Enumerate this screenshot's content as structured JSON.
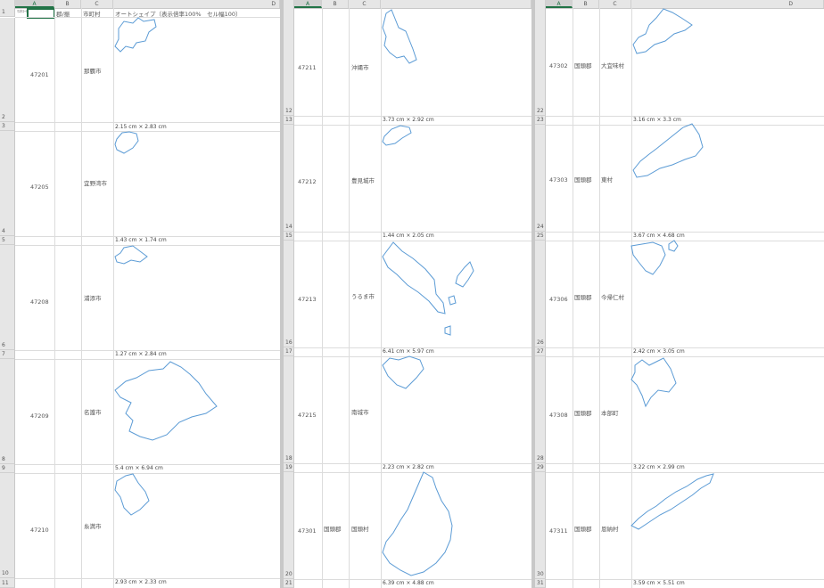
{
  "columns": [
    "A",
    "B",
    "C",
    "D"
  ],
  "header_row": {
    "a1": "ﾏｽﾀｺｰﾄﾞ",
    "b1": "郡/振",
    "c1": "市町村",
    "d1": "オートシェイプ（表示倍率100%　セル幅100）"
  },
  "pane1": {
    "rows": [
      {
        "code": "47201",
        "gun": "",
        "city": "那覇市",
        "dim": "2.15 cm × 2.83 cm",
        "r_top": "2",
        "r_bot": "3"
      },
      {
        "code": "47205",
        "gun": "",
        "city": "宜野湾市",
        "dim": "1.43 cm × 1.74 cm",
        "r_top": "4",
        "r_bot": "5"
      },
      {
        "code": "47208",
        "gun": "",
        "city": "浦添市",
        "dim": "1.27 cm × 2.84 cm",
        "r_top": "6",
        "r_bot": "7"
      },
      {
        "code": "47209",
        "gun": "",
        "city": "名護市",
        "dim": "5.4 cm × 6.94 cm",
        "r_top": "8",
        "r_bot": "9"
      },
      {
        "code": "47210",
        "gun": "",
        "city": "糸満市",
        "dim": "2.93 cm × 2.33 cm",
        "r_top": "10",
        "r_bot": "11"
      }
    ]
  },
  "pane2": {
    "rows": [
      {
        "code": "47211",
        "gun": "",
        "city": "沖縄市",
        "dim": "3.73 cm × 2.92 cm",
        "r_top": "12",
        "r_bot": "13"
      },
      {
        "code": "47212",
        "gun": "",
        "city": "豊見城市",
        "dim": "1.44 cm × 2.05 cm",
        "r_top": "14",
        "r_bot": "15"
      },
      {
        "code": "47213",
        "gun": "",
        "city": "うるま市",
        "dim": "6.41 cm × 5.97 cm",
        "r_top": "16",
        "r_bot": "17"
      },
      {
        "code": "47215",
        "gun": "",
        "city": "南城市",
        "dim": "2.23 cm × 2.82 cm",
        "r_top": "18",
        "r_bot": "19"
      },
      {
        "code": "47301",
        "gun": "国頭郡",
        "city": "国頭村",
        "dim": "6.39 cm × 4.88 cm",
        "r_top": "20",
        "r_bot": "21"
      }
    ]
  },
  "pane3": {
    "rows": [
      {
        "code": "47302",
        "gun": "国頭郡",
        "city": "大宜味村",
        "dim": "3.16 cm × 3.3 cm",
        "r_top": "22",
        "r_bot": "23"
      },
      {
        "code": "47303",
        "gun": "国頭郡",
        "city": "東村",
        "dim": "3.67 cm × 4.68 cm",
        "r_top": "24",
        "r_bot": "25"
      },
      {
        "code": "47306",
        "gun": "国頭郡",
        "city": "今帰仁村",
        "dim": "2.42 cm × 3.05 cm",
        "r_top": "26",
        "r_bot": "27"
      },
      {
        "code": "47308",
        "gun": "国頭郡",
        "city": "本部町",
        "dim": "3.22 cm × 2.99 cm",
        "r_top": "28",
        "r_bot": "29"
      },
      {
        "code": "47311",
        "gun": "国頭郡",
        "city": "恩納村",
        "dim": "3.59 cm × 5.51 cm",
        "r_top": "30",
        "r_bot": "31"
      }
    ]
  },
  "row1_label": "1",
  "shape_color": "#5b9bd5",
  "accent_color": "#217346"
}
